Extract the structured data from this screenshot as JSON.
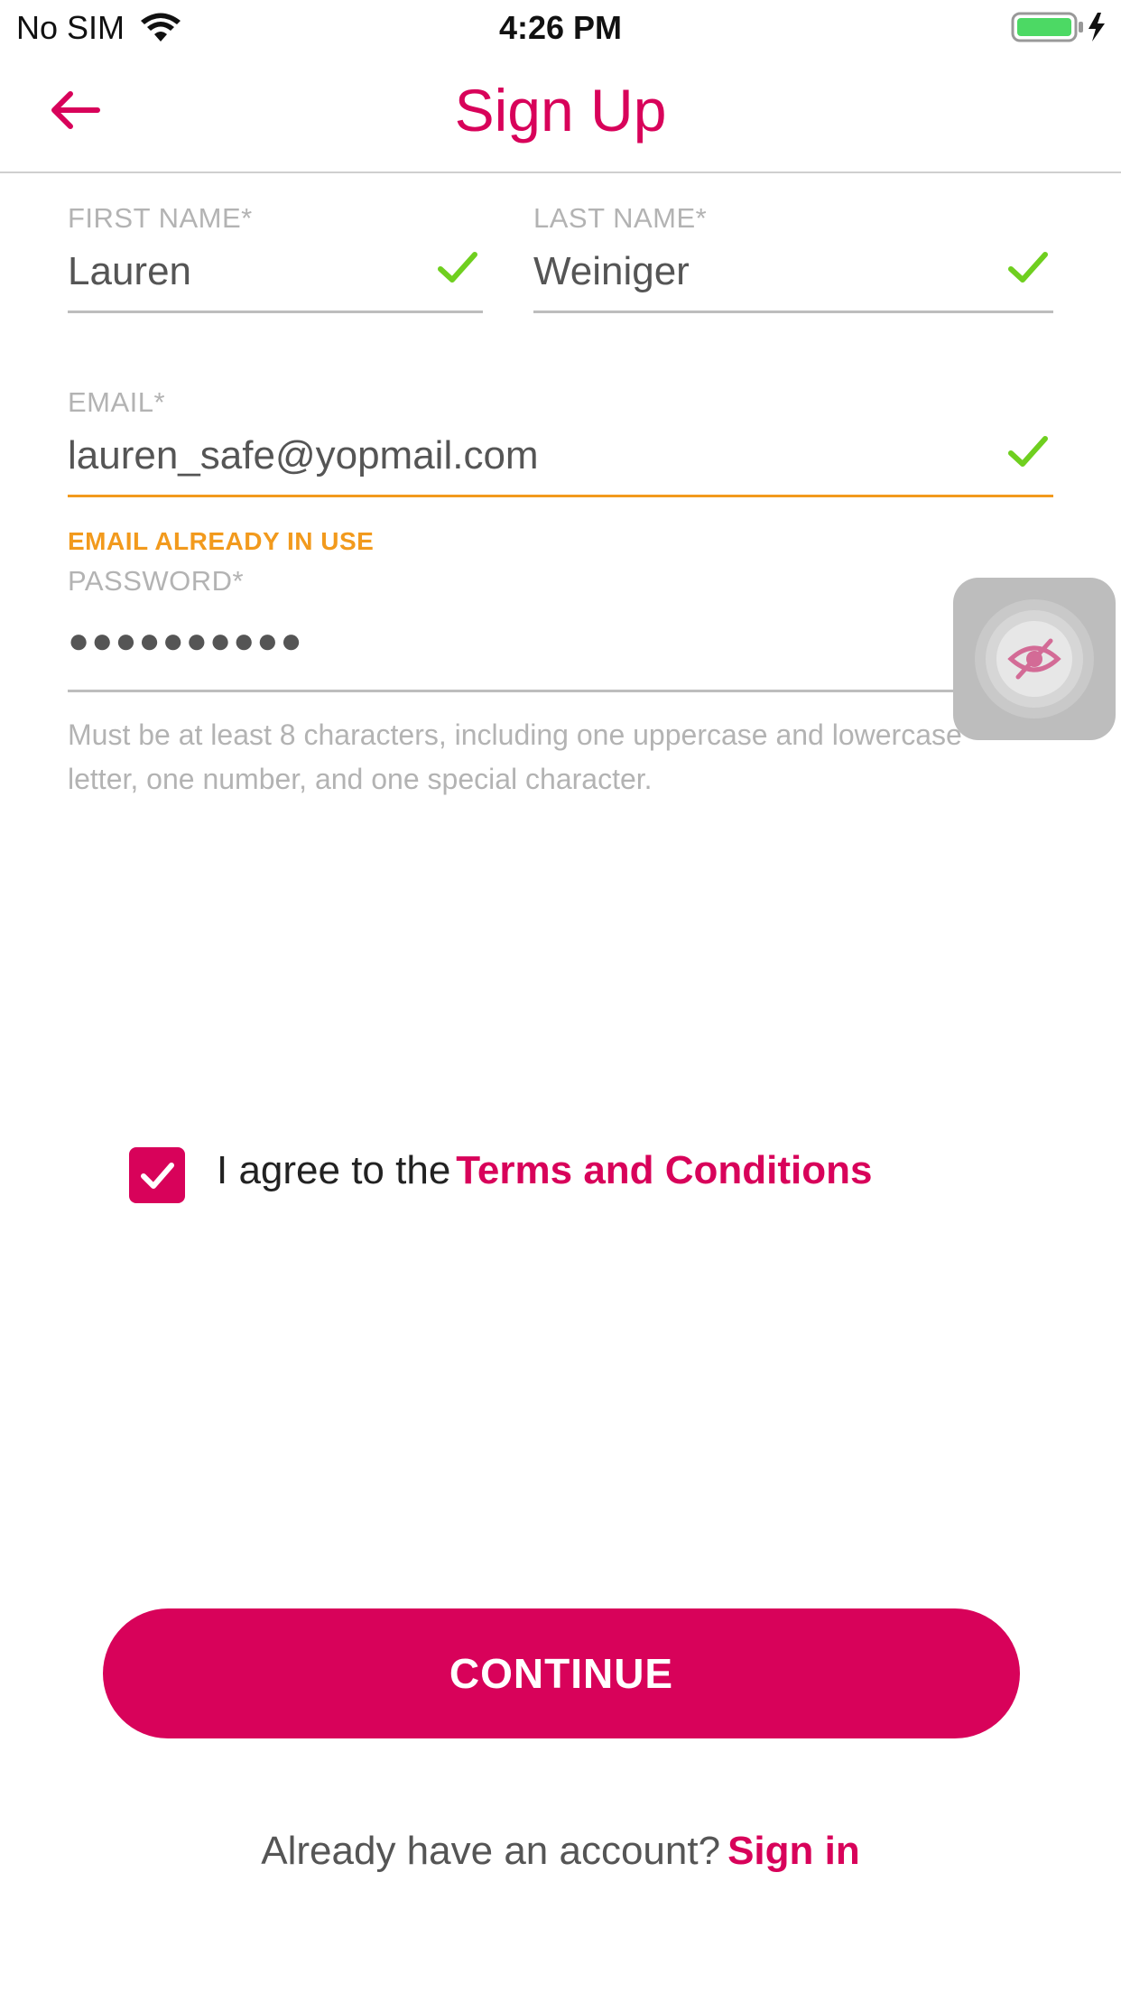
{
  "status_bar": {
    "carrier": "No SIM",
    "time": "4:26 PM",
    "battery_icon": "battery-charging-icon",
    "wifi_icon": "wifi-icon"
  },
  "nav": {
    "title": "Sign Up",
    "back_icon": "back-arrow-icon"
  },
  "form": {
    "first_name": {
      "label": "FIRST NAME*",
      "value": "Lauren",
      "valid": true
    },
    "last_name": {
      "label": "LAST NAME*",
      "value": "Weiniger",
      "valid": true
    },
    "email": {
      "label": "EMAIL*",
      "value": "lauren_safe@yopmail.com",
      "valid": true,
      "error": "EMAIL ALREADY IN USE"
    },
    "password": {
      "label": "PASSWORD*",
      "value": "●●●●●●●●●●",
      "helper": "Must be at least 8 characters, including one uppercase and lowercase letter, one number, and one special character.",
      "toggle_icon": "eye-slash-icon"
    }
  },
  "terms": {
    "checked": true,
    "prefix": "I agree to the",
    "link": "Terms and Conditions"
  },
  "actions": {
    "continue_label": "CONTINUE",
    "signin_prompt": "Already have an account?",
    "signin_link": "Sign in"
  },
  "colors": {
    "accent": "#d8025a",
    "valid": "#6fcf1f",
    "warning": "#f29a1d",
    "muted": "#b3b3b3"
  }
}
